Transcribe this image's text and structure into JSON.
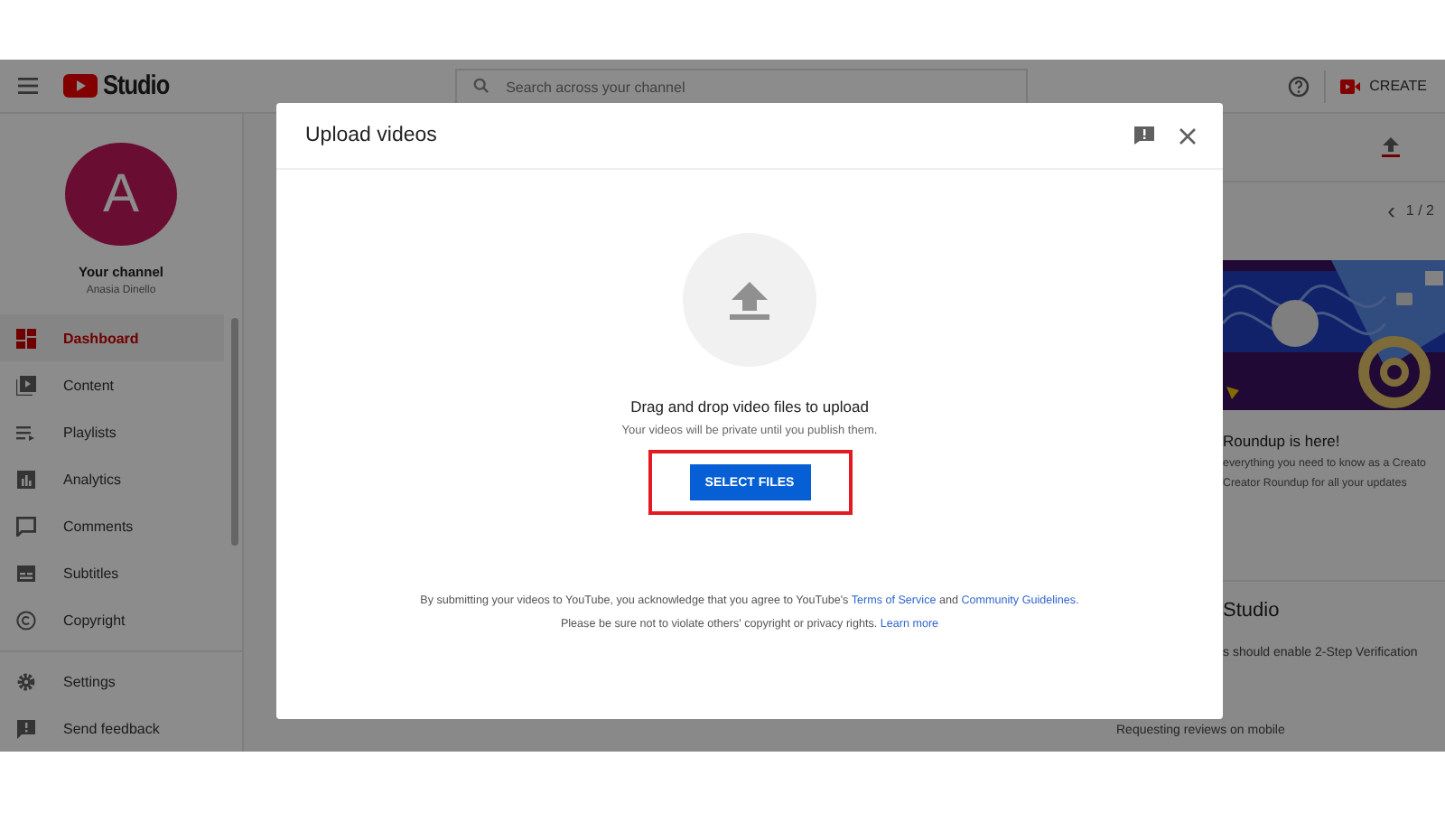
{
  "header": {
    "logo_text": "Studio",
    "search": {
      "placeholder": "Search across your channel"
    },
    "create_label": "CREATE"
  },
  "sidebar": {
    "avatar_letter": "A",
    "channel_title": "Your channel",
    "channel_name": "Anasia Dinello",
    "items": [
      {
        "label": "Dashboard",
        "selected": true
      },
      {
        "label": "Content",
        "selected": false
      },
      {
        "label": "Playlists",
        "selected": false
      },
      {
        "label": "Analytics",
        "selected": false
      },
      {
        "label": "Comments",
        "selected": false
      },
      {
        "label": "Subtitles",
        "selected": false
      },
      {
        "label": "Copyright",
        "selected": false
      }
    ],
    "footer_items": [
      {
        "label": "Settings",
        "selected": false
      },
      {
        "label": "Send feedback",
        "selected": false
      }
    ]
  },
  "news": {
    "prev": "‹",
    "pager": "1 / 2",
    "title": "Roundup is here!",
    "lines": [
      "everything you need to know as a Creato",
      "Creator Roundup for all your updates"
    ]
  },
  "ideas": {
    "title": "Studio",
    "line": "s should enable 2-Step Verification",
    "last_line": "Requesting reviews on mobile"
  },
  "dialog": {
    "title": "Upload videos",
    "heading": "Drag and drop video files to upload",
    "subtitle": "Your videos will be private until you publish them.",
    "button": "SELECT FILES",
    "button_highlighted": true,
    "legal": "By submitting your videos to YouTube, you acknowledge that you agree to YouTube's",
    "terms_link": "Terms of Service",
    "and": "and",
    "guidelines_link": "Community Guidelines.",
    "rights": "Please be sure not to violate others' copyright or privacy rights.",
    "learn_link": "Learn more"
  }
}
